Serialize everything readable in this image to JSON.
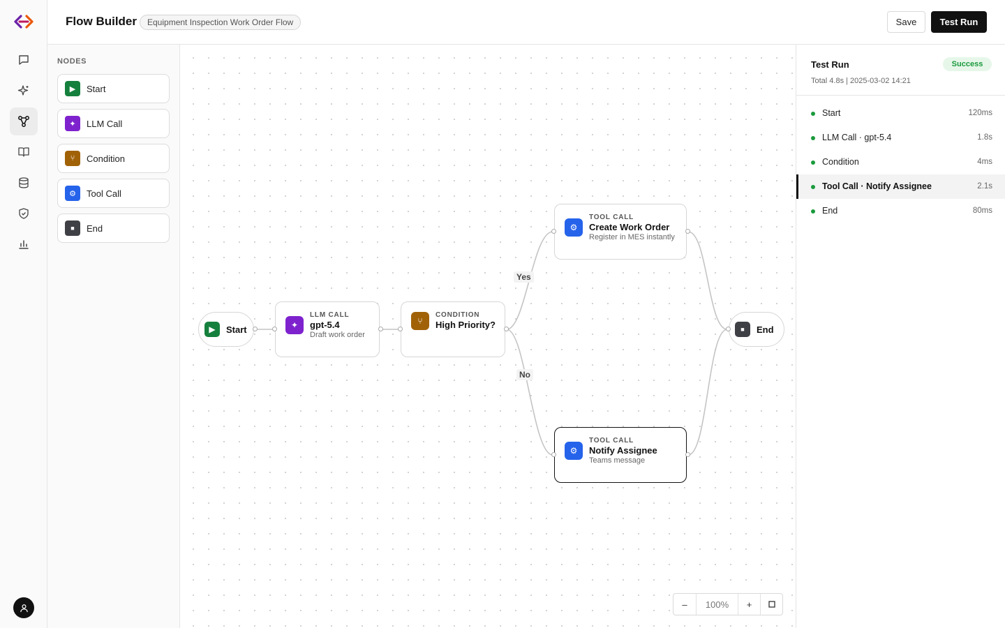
{
  "app": {
    "title": "Flow Builder",
    "flow_name": "Equipment Inspection Work Order Flow",
    "save_label": "Save",
    "test_run_label": "Test Run"
  },
  "colors": {
    "start": "#15803d",
    "llm": "#7e22ce",
    "condition": "#a16207",
    "tool": "#2563eb",
    "end": "#3f3f46",
    "success": "#1a9a3c"
  },
  "rail": {
    "items": [
      {
        "icon": "chat-icon"
      },
      {
        "icon": "sparkle-icon"
      },
      {
        "icon": "flow-icon",
        "active": true
      },
      {
        "icon": "book-icon"
      },
      {
        "icon": "database-icon"
      },
      {
        "icon": "shield-icon"
      },
      {
        "icon": "chart-icon"
      }
    ],
    "avatar_icon": "user-icon"
  },
  "palette": {
    "title": "NODES",
    "items": [
      {
        "label": "Start",
        "icon": "play-icon",
        "glyph": "▶"
      },
      {
        "label": "LLM Call",
        "icon": "sparkle-icon",
        "glyph": "✦"
      },
      {
        "label": "Condition",
        "icon": "branch-icon",
        "glyph": "⑂"
      },
      {
        "label": "Tool Call",
        "icon": "gear-icon",
        "glyph": "⚙"
      },
      {
        "label": "End",
        "icon": "stop-icon",
        "glyph": "■"
      }
    ]
  },
  "canvas": {
    "nodes": {
      "start": {
        "label": "Start",
        "glyph": "▶"
      },
      "llm": {
        "kind": "LLM CALL",
        "name": "gpt-5.4",
        "desc": "Draft work order",
        "glyph": "✦"
      },
      "condition": {
        "kind": "CONDITION",
        "name": "High Priority?",
        "glyph": "⑂"
      },
      "create": {
        "kind": "TOOL CALL",
        "name": "Create Work Order",
        "desc": "Register in MES instantly",
        "glyph": "⚙"
      },
      "notify": {
        "kind": "TOOL CALL",
        "name": "Notify Assignee",
        "desc": "Teams message",
        "glyph": "⚙"
      },
      "end": {
        "label": "End",
        "glyph": "■"
      }
    },
    "edge_labels": {
      "yes": "Yes",
      "no": "No"
    },
    "zoom": {
      "minus": "–",
      "level": "100%",
      "plus": "+",
      "fit": "□"
    }
  },
  "run": {
    "title": "Test Run",
    "status": "Success",
    "meta": "Total 4.8s  |  2025-03-02 14:21",
    "steps": [
      {
        "label": "Start",
        "time": "120ms"
      },
      {
        "label": "LLM Call · gpt-5.4",
        "time": "1.8s"
      },
      {
        "label": "Condition",
        "time": "4ms"
      },
      {
        "label": "Tool Call · Notify Assignee",
        "time": "2.1s",
        "active": true
      },
      {
        "label": "End",
        "time": "80ms"
      }
    ]
  }
}
